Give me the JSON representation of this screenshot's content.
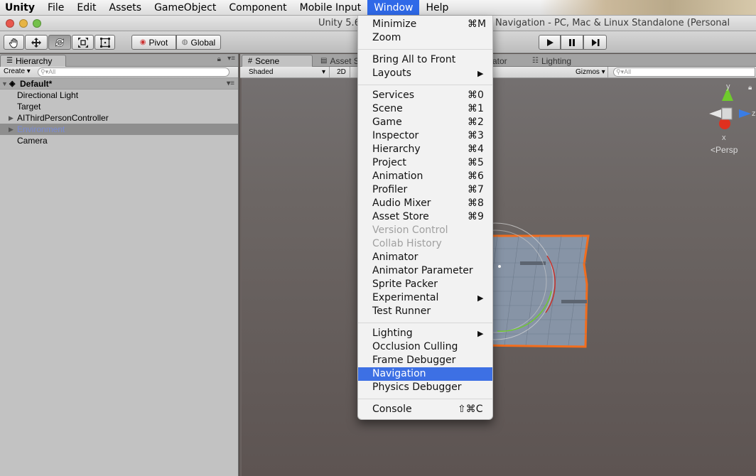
{
  "menubar": {
    "app": "Unity",
    "items": [
      "File",
      "Edit",
      "Assets",
      "GameObject",
      "Component",
      "Mobile Input",
      "Window",
      "Help"
    ],
    "active": "Window"
  },
  "window": {
    "title": "Unity 5.6",
    "title_tail": ".unity - Navigation - PC, Mac & Linux Standalone (Personal"
  },
  "toolbar": {
    "pivot": "Pivot",
    "global": "Global"
  },
  "hierarchy": {
    "tab_label": "Hierarchy",
    "create_label": "Create",
    "search_placeholder": "All",
    "scene_name": "Default*",
    "items": [
      "Directional Light",
      "Target",
      "AIThirdPersonController",
      "Environment",
      "Camera"
    ]
  },
  "scene": {
    "tabs": [
      "Scene",
      "Asset St",
      "ator",
      "Lighting"
    ],
    "shading": "Shaded",
    "mode_2d": "2D",
    "gizmos": "Gizmos",
    "search_placeholder": "All",
    "persp_label": "Persp",
    "axis_y": "y",
    "axis_z": "z",
    "axis_x": "x"
  },
  "window_menu": {
    "items": [
      {
        "label": "Minimize",
        "shortcut": "⌘M"
      },
      {
        "label": "Zoom",
        "shortcut": ""
      },
      {
        "label": "Bring All to Front",
        "shortcut": ""
      },
      {
        "label": "Layouts",
        "shortcut": ""
      },
      {
        "label": "Services",
        "shortcut": "⌘0"
      },
      {
        "label": "Scene",
        "shortcut": "⌘1"
      },
      {
        "label": "Game",
        "shortcut": "⌘2"
      },
      {
        "label": "Inspector",
        "shortcut": "⌘3"
      },
      {
        "label": "Hierarchy",
        "shortcut": "⌘4"
      },
      {
        "label": "Project",
        "shortcut": "⌘5"
      },
      {
        "label": "Animation",
        "shortcut": "⌘6"
      },
      {
        "label": "Profiler",
        "shortcut": "⌘7"
      },
      {
        "label": "Audio Mixer",
        "shortcut": "⌘8"
      },
      {
        "label": "Asset Store",
        "shortcut": "⌘9"
      },
      {
        "label": "Version Control",
        "shortcut": ""
      },
      {
        "label": "Collab History",
        "shortcut": ""
      },
      {
        "label": "Animator",
        "shortcut": ""
      },
      {
        "label": "Animator Parameter",
        "shortcut": ""
      },
      {
        "label": "Sprite Packer",
        "shortcut": ""
      },
      {
        "label": "Experimental",
        "shortcut": ""
      },
      {
        "label": "Test Runner",
        "shortcut": ""
      },
      {
        "label": "Lighting",
        "shortcut": ""
      },
      {
        "label": "Occlusion Culling",
        "shortcut": ""
      },
      {
        "label": "Frame Debugger",
        "shortcut": ""
      },
      {
        "label": "Navigation",
        "shortcut": ""
      },
      {
        "label": "Physics Debugger",
        "shortcut": ""
      },
      {
        "label": "Console",
        "shortcut": "⇧⌘C"
      }
    ],
    "highlighted": "Navigation",
    "disabled": [
      "Version Control",
      "Collab History"
    ],
    "submenus": [
      "Layouts",
      "Experimental",
      "Lighting"
    ]
  },
  "colors": {
    "menu_highlight": "#3d70e4",
    "selection_outline": "#f26d1d",
    "axis_y": "#6fcb2c",
    "axis_z": "#3a7de6",
    "axis_x": "#e0301e"
  }
}
